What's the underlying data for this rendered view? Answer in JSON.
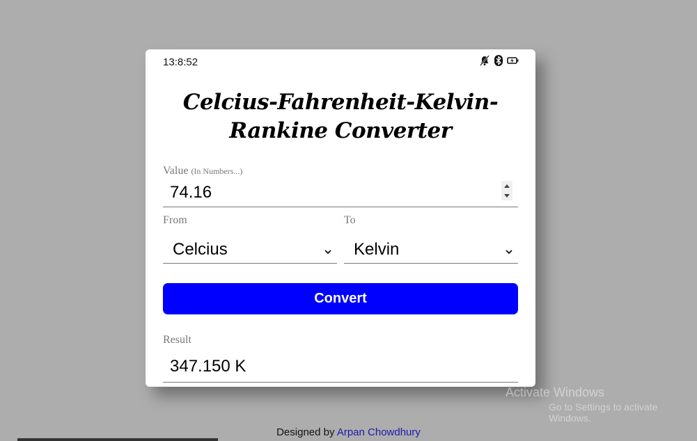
{
  "status": {
    "time": "13:8:52",
    "icons": [
      "mute-bell-icon",
      "bluetooth-icon",
      "battery-charging-icon"
    ]
  },
  "title": "Celcius-Fahrenheit-Kelvin-Rankine Converter",
  "value_field": {
    "label": "Value",
    "hint": "(In Numbers...)",
    "value": "74.16"
  },
  "from_field": {
    "label": "From",
    "selected": "Celcius"
  },
  "to_field": {
    "label": "To",
    "selected": "Kelvin"
  },
  "convert_label": "Convert",
  "result": {
    "label": "Result",
    "value": "347.150 K"
  },
  "footer": {
    "prefix": "Designed by",
    "author": "Arpan Chowdhury"
  },
  "watermark": {
    "line1": "Activate Windows",
    "line2": "Go to Settings to activate Windows."
  },
  "colors": {
    "background": "#adadad",
    "button": "#0000ff",
    "link": "#1a1ab0"
  }
}
